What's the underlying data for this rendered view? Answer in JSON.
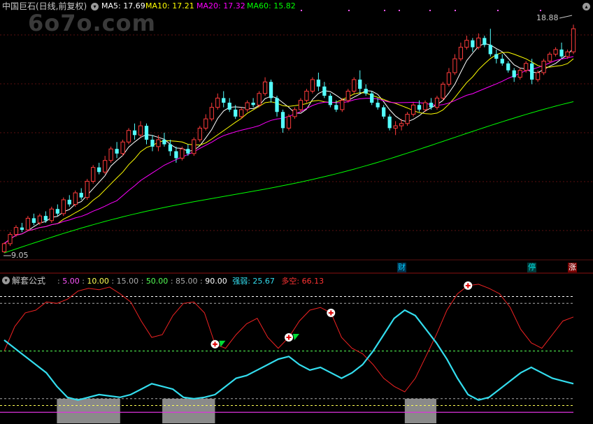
{
  "main": {
    "title": "中国巨石(日线,前复权)",
    "ma_labels": [
      "MA5: 17.69",
      "MA10: 17.21",
      "MA20: 17.32",
      "MA60: 15.82"
    ],
    "ma_colors": [
      "#ffffff",
      "#ffff00",
      "#ff00ff",
      "#00ff00"
    ],
    "price_high_label": "18.88",
    "price_low_label": "9.05",
    "watermark": "6o7o.com",
    "event_tags": [
      "财",
      "停",
      "涨"
    ]
  },
  "indicator": {
    "name": "解套公式",
    "levels": [
      "5.00",
      "10.00",
      "15.00",
      "50.00",
      "85.00",
      "90.00"
    ],
    "level_colors": [
      "#ff55ff",
      "#ffff55",
      "#aaaaaa",
      "#55ff55",
      "#aaaaaa",
      "#ffffff"
    ],
    "strength_label": "强弱: 25.67",
    "longshort_label": "多空: 66.13",
    "strength_value": 25.67,
    "longshort_value": 66.13
  },
  "chart_data": {
    "type": "candlestick",
    "price_range": [
      9.05,
      18.88
    ],
    "candles": [
      [
        9.05,
        9.4,
        9.0,
        9.45
      ],
      [
        9.4,
        9.8,
        9.3,
        9.9
      ],
      [
        9.8,
        10.1,
        9.7,
        10.2
      ],
      [
        10.1,
        10.0,
        9.9,
        10.3
      ],
      [
        10.0,
        10.5,
        9.95,
        10.6
      ],
      [
        10.5,
        10.3,
        10.2,
        10.7
      ],
      [
        10.3,
        10.6,
        10.2,
        10.7
      ],
      [
        10.6,
        10.4,
        10.3,
        10.8
      ],
      [
        10.4,
        10.9,
        10.3,
        11.0
      ],
      [
        10.9,
        10.7,
        10.6,
        11.1
      ],
      [
        10.7,
        11.3,
        10.6,
        11.4
      ],
      [
        11.3,
        11.1,
        11.0,
        11.5
      ],
      [
        11.1,
        11.6,
        11.0,
        11.7
      ],
      [
        11.6,
        11.4,
        11.3,
        11.8
      ],
      [
        11.4,
        12.1,
        11.3,
        12.2
      ],
      [
        12.1,
        12.7,
        12.0,
        12.8
      ],
      [
        12.7,
        12.5,
        12.4,
        12.9
      ],
      [
        12.5,
        13.0,
        12.4,
        13.2
      ],
      [
        13.0,
        13.5,
        12.9,
        13.6
      ],
      [
        13.5,
        13.3,
        13.1,
        13.8
      ],
      [
        13.3,
        13.8,
        13.2,
        13.9
      ],
      [
        13.8,
        14.3,
        13.7,
        14.4
      ],
      [
        14.3,
        14.1,
        13.9,
        14.6
      ],
      [
        14.1,
        14.5,
        14.0,
        14.7
      ],
      [
        14.5,
        13.9,
        13.7,
        14.6
      ],
      [
        13.9,
        13.6,
        13.4,
        14.1
      ],
      [
        13.6,
        13.9,
        13.4,
        14.1
      ],
      [
        13.9,
        13.7,
        13.6,
        14.2
      ],
      [
        13.7,
        13.4,
        13.2,
        13.9
      ],
      [
        13.4,
        13.1,
        12.9,
        13.6
      ],
      [
        13.1,
        13.5,
        13.0,
        13.6
      ],
      [
        13.5,
        13.3,
        13.2,
        13.7
      ],
      [
        13.3,
        13.9,
        13.2,
        14.0
      ],
      [
        13.9,
        14.4,
        13.8,
        14.5
      ],
      [
        14.4,
        14.8,
        14.3,
        15.0
      ],
      [
        14.8,
        15.3,
        14.7,
        15.5
      ],
      [
        15.3,
        15.7,
        15.2,
        15.9
      ],
      [
        15.7,
        15.5,
        15.3,
        16.0
      ],
      [
        15.5,
        15.2,
        15.1,
        15.7
      ],
      [
        15.2,
        14.9,
        14.8,
        15.4
      ],
      [
        14.9,
        15.2,
        14.8,
        15.3
      ],
      [
        15.2,
        15.5,
        15.1,
        15.6
      ],
      [
        15.5,
        15.4,
        15.3,
        15.7
      ],
      [
        15.4,
        15.9,
        15.3,
        16.0
      ],
      [
        15.9,
        16.4,
        15.8,
        16.6
      ],
      [
        16.4,
        15.7,
        15.5,
        16.5
      ],
      [
        15.7,
        15.1,
        14.9,
        15.8
      ],
      [
        15.1,
        14.4,
        14.2,
        15.2
      ],
      [
        14.4,
        14.9,
        14.3,
        15.0
      ],
      [
        14.9,
        15.2,
        14.8,
        15.3
      ],
      [
        15.2,
        15.6,
        15.1,
        15.7
      ],
      [
        15.6,
        16.0,
        15.5,
        16.1
      ],
      [
        16.0,
        16.5,
        15.9,
        16.6
      ],
      [
        16.5,
        16.2,
        16.0,
        16.8
      ],
      [
        16.2,
        15.8,
        15.7,
        16.4
      ],
      [
        15.8,
        15.4,
        15.3,
        15.9
      ],
      [
        15.4,
        15.2,
        15.1,
        15.6
      ],
      [
        15.2,
        15.6,
        15.1,
        15.7
      ],
      [
        15.6,
        16.0,
        15.5,
        16.1
      ],
      [
        16.0,
        16.5,
        15.9,
        16.6
      ],
      [
        16.5,
        16.1,
        15.9,
        16.9
      ],
      [
        16.1,
        15.9,
        15.8,
        16.3
      ],
      [
        15.9,
        15.5,
        15.4,
        16.0
      ],
      [
        15.5,
        15.3,
        15.2,
        15.7
      ],
      [
        15.3,
        14.9,
        14.8,
        15.4
      ],
      [
        14.9,
        14.4,
        14.3,
        15.0
      ],
      [
        14.4,
        14.5,
        14.1,
        14.7
      ],
      [
        14.5,
        14.6,
        14.3,
        14.8
      ],
      [
        14.6,
        15.0,
        14.5,
        15.1
      ],
      [
        15.0,
        15.4,
        14.9,
        15.5
      ],
      [
        15.4,
        15.2,
        15.1,
        15.6
      ],
      [
        15.2,
        15.5,
        15.1,
        15.6
      ],
      [
        15.5,
        15.3,
        15.2,
        15.7
      ],
      [
        15.3,
        15.7,
        15.2,
        15.8
      ],
      [
        15.7,
        16.3,
        15.6,
        16.4
      ],
      [
        16.3,
        16.8,
        16.2,
        17.0
      ],
      [
        16.8,
        17.4,
        16.7,
        17.6
      ],
      [
        17.4,
        17.9,
        17.3,
        18.1
      ],
      [
        17.9,
        18.2,
        17.8,
        18.4
      ],
      [
        18.2,
        17.9,
        17.7,
        18.3
      ],
      [
        17.9,
        18.3,
        17.8,
        18.5
      ],
      [
        18.3,
        18.0,
        17.9,
        18.4
      ],
      [
        18.0,
        17.6,
        17.5,
        18.7
      ],
      [
        17.6,
        17.4,
        17.2,
        17.8
      ],
      [
        17.4,
        17.2,
        17.1,
        17.6
      ],
      [
        17.2,
        16.9,
        16.8,
        17.3
      ],
      [
        16.9,
        16.6,
        16.4,
        17.0
      ],
      [
        16.6,
        16.9,
        16.5,
        17.0
      ],
      [
        16.9,
        17.2,
        16.8,
        17.3
      ],
      [
        17.2,
        16.5,
        16.3,
        17.4
      ],
      [
        16.5,
        16.8,
        16.4,
        16.9
      ],
      [
        16.8,
        17.3,
        16.7,
        17.4
      ],
      [
        17.3,
        17.6,
        17.2,
        17.7
      ],
      [
        17.6,
        17.8,
        17.5,
        17.9
      ],
      [
        17.8,
        17.5,
        17.4,
        18.1
      ],
      [
        17.5,
        17.7,
        17.4,
        17.8
      ],
      [
        17.7,
        18.7,
        17.6,
        18.88
      ]
    ],
    "indicator": {
      "red_line": [
        50,
        68,
        78,
        80,
        86,
        85,
        88,
        94,
        96,
        95,
        97,
        92,
        86,
        72,
        60,
        62,
        76,
        85,
        86,
        78,
        55,
        52,
        62,
        70,
        74,
        60,
        52,
        60,
        72,
        80,
        82,
        78,
        60,
        52,
        48,
        40,
        30,
        24,
        20,
        30,
        46,
        62,
        80,
        92,
        98,
        99,
        96,
        92,
        82,
        66,
        56,
        52,
        62,
        72,
        75
      ],
      "blue_line": [
        58,
        52,
        46,
        40,
        34,
        24,
        16,
        14,
        16,
        18,
        17,
        16,
        18,
        22,
        26,
        24,
        22,
        16,
        15,
        16,
        18,
        24,
        30,
        32,
        36,
        40,
        44,
        46,
        40,
        36,
        38,
        34,
        30,
        34,
        40,
        50,
        62,
        74,
        80,
        76,
        66,
        56,
        44,
        30,
        18,
        14,
        16,
        22,
        28,
        34,
        38,
        34,
        30,
        28,
        26
      ],
      "buy_markers": [
        20,
        27,
        31,
        44
      ],
      "gray_zones": [
        [
          5,
          11
        ],
        [
          15,
          20
        ],
        [
          38,
          41
        ]
      ]
    }
  }
}
